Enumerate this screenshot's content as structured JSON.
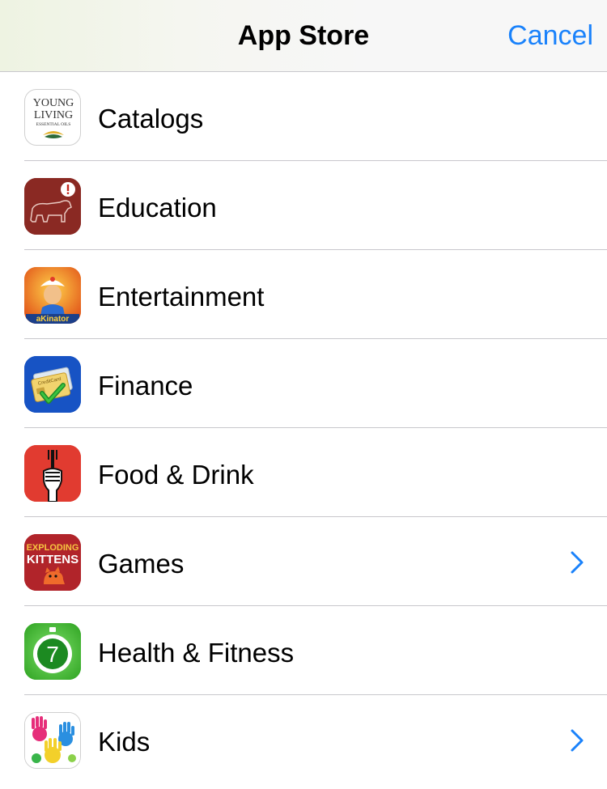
{
  "navbar": {
    "title": "App Store",
    "cancel_label": "Cancel"
  },
  "categories": [
    {
      "label": "Catalogs",
      "icon": "young-living-icon",
      "has_chevron": false
    },
    {
      "label": "Education",
      "icon": "dog-alert-icon",
      "has_chevron": false
    },
    {
      "label": "Entertainment",
      "icon": "akinator-icon",
      "has_chevron": false
    },
    {
      "label": "Finance",
      "icon": "credit-card-check-icon",
      "has_chevron": false
    },
    {
      "label": "Food & Drink",
      "icon": "hand-fork-icon",
      "has_chevron": false
    },
    {
      "label": "Games",
      "icon": "exploding-kittens-icon",
      "has_chevron": true
    },
    {
      "label": "Health & Fitness",
      "icon": "stopwatch-seven-icon",
      "has_chevron": false
    },
    {
      "label": "Kids",
      "icon": "painted-hands-icon",
      "has_chevron": true
    }
  ],
  "icon_text": {
    "catalogs": [
      "YOUNG",
      "LIVING",
      "ESSENTIAL OILS"
    ],
    "entertainment": "aKinator",
    "finance": "CreditCard",
    "games": [
      "EXPLODING",
      "KITTENS"
    ],
    "health": "7"
  },
  "colors": {
    "accent": "#1a82fb",
    "separator": "#c8c7cc"
  }
}
